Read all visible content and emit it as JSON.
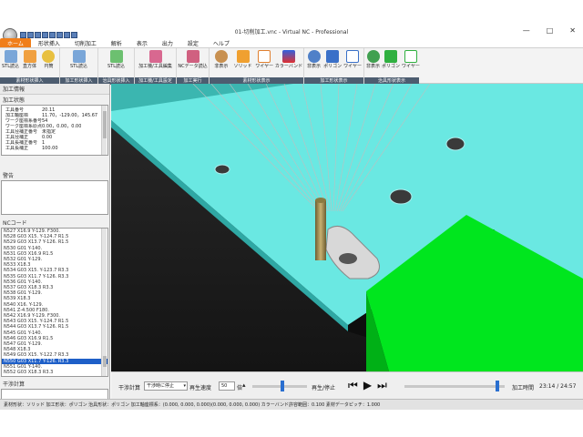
{
  "window": {
    "title": "01-切削加工.vnc - Virtual NC - Professional",
    "min": "—",
    "max": "□",
    "close": "✕"
  },
  "ribbon_tabs": [
    "ホーム",
    "形状挿入",
    "切削加工",
    "解析",
    "表示",
    "出力",
    "設定",
    "ヘルプ"
  ],
  "ribbon_groups": [
    {
      "label": "素材形状挿入",
      "buttons": [
        "STL読込",
        "直方体",
        "円筒"
      ]
    },
    {
      "label": "加工形状挿入",
      "buttons": [
        "STL読込"
      ]
    },
    {
      "label": "治具形状挿入",
      "buttons": [
        "STL読込"
      ]
    },
    {
      "label": "加工機/工具設定",
      "buttons": [
        "加工機/工具編集"
      ]
    },
    {
      "label": "加工実行",
      "buttons": [
        "NCデータ読込"
      ]
    },
    {
      "label": "素材形状表示",
      "buttons": [
        "非表示",
        "ソリッド",
        "ワイヤー",
        "カラーバンド"
      ]
    },
    {
      "label": "加工形状表示",
      "buttons": [
        "非表示",
        "ポリゴン",
        "ワイヤー"
      ]
    },
    {
      "label": "治具形状表示",
      "buttons": [
        "非表示",
        "ポリゴン",
        "ワイヤー"
      ]
    }
  ],
  "left": {
    "viewer_title": "加工情報",
    "info_title": "加工状態",
    "info_rows": [
      {
        "k": "工具番号",
        "v": "20.11"
      },
      {
        "k": "加工軸座標",
        "v": "11.70，-129.00，145.67"
      },
      {
        "k": "ワーク座標系番号",
        "v": "54"
      },
      {
        "k": "ワーク座標系原点",
        "v": "0.00，0.00，0.00"
      },
      {
        "k": "工具径補正番号",
        "v": "未指定"
      },
      {
        "k": "工具径補正",
        "v": "0.00"
      },
      {
        "k": "工具長補正番号",
        "v": "1"
      },
      {
        "k": "工具長補正",
        "v": "100.00"
      }
    ],
    "alarm_title": "警告",
    "nc_title": "NCコード",
    "nc_lines": [
      "N527 X16.9 Y-129. F300.",
      "N528 G03 X15. Y-124.7 R1.5",
      "N529 G03 X13.7 Y-126. R1.5",
      "N530 G01 Y-140.",
      "N531 G03 X16.9 R1.5",
      "N532 G01 Y-129.",
      "N533 X18.3",
      "N534 G03 X15. Y-123.7 R3.3",
      "N535 G03 X11.7 Y-126. R3.3",
      "N536 G01 Y-140.",
      "N537 G03 X18.3 R3.3",
      "N538 G01 Y-129.",
      "N539 X18.3",
      "N540 X16. Y-129.",
      "N541 Z-4.500 F180.",
      "N542 X16.9 Y-129. F300.",
      "N543 G03 X15. Y-124.7 R1.5",
      "N544 G03 X13.7 Y-126. R1.5",
      "N545 G01 Y-140.",
      "N546 G03 X16.9 R1.5",
      "N547 G01 Y-129.",
      "N548 X18.3",
      "N549 G03 X15. Y-122.7 R3.3",
      "N550 G03 X11.7 Y-126. R3.3",
      "N551 G01 Y-140.",
      "N552 G03 X18.3 R3.3"
    ],
    "nc_selected_index": 23,
    "calc_title": "干渉計算"
  },
  "controls": {
    "interference_label": "干渉計算",
    "interference_value": "干渉時に停止",
    "speed_label": "再生速度",
    "speed_value": "50",
    "speed_unit": "倍",
    "play_label": "再生/停止",
    "time_label": "加工時間",
    "time_value": "23:14 / 24:57",
    "speed_position": 0.55,
    "timeline_position": 0.93
  },
  "status": {
    "text": "素材形状：ソリッド  加工形状：ポリゴン  治具形状：ポリゴン  加工軸座標系：(0.000, 0.000, 0.000)(0.000, 0.000, 0.000)  カラーバンド許容範囲：0.100  素材データピッチ：1.000"
  },
  "colors": {
    "accent": "#f07e1a",
    "workpiece": "#5ee6e0",
    "fixture": "#00e01a",
    "status_bar": "#4d5d70"
  }
}
